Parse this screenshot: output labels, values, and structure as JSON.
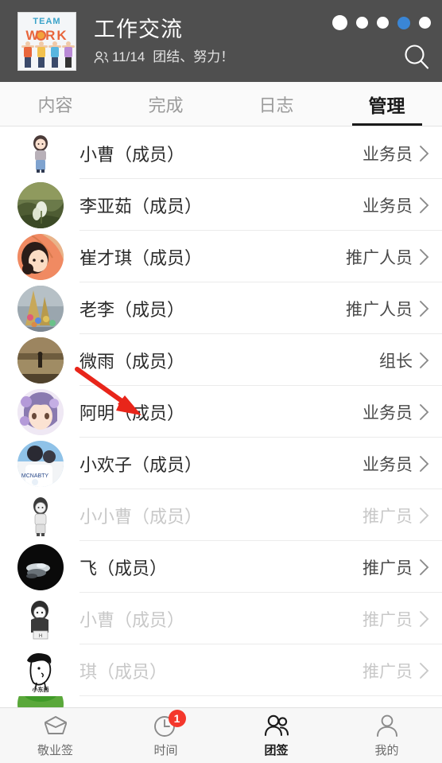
{
  "header": {
    "logo": {
      "name": "team-work-logo",
      "line1": "TEAM",
      "line2": "W  RK"
    },
    "title": "工作交流",
    "members_count": "11/14",
    "slogan": "团结、努力！",
    "people_icon": "people-icon",
    "search_icon": "search-icon",
    "dots": [
      "white",
      "white",
      "white",
      "blue",
      "white"
    ],
    "accent_dot_color": "#3a86d6",
    "background_color": "#4f4f4f"
  },
  "tabs": [
    {
      "label": "内容",
      "active": false
    },
    {
      "label": "完成",
      "active": false
    },
    {
      "label": "日志",
      "active": false
    },
    {
      "label": "管理",
      "active": true
    }
  ],
  "members": [
    {
      "name": "小曹（成员）",
      "role": "业务员",
      "dim": false
    },
    {
      "name": "李亚茹（成员）",
      "role": "业务员",
      "dim": false
    },
    {
      "name": "崔才琪（成员）",
      "role": "推广人员",
      "dim": false
    },
    {
      "name": "老李（成员）",
      "role": "推广人员",
      "dim": false
    },
    {
      "name": "微雨（成员）",
      "role": "组长",
      "dim": false
    },
    {
      "name": "阿明（成员）",
      "role": "业务员",
      "dim": false
    },
    {
      "name": "小欢子（成员）",
      "role": "业务员",
      "dim": false
    },
    {
      "name": "小小曹（成员）",
      "role": "推广员",
      "dim": true
    },
    {
      "name": "飞（成员）",
      "role": "推广员",
      "dim": false
    },
    {
      "name": "小曹（成员）",
      "role": "推广员",
      "dim": true
    },
    {
      "name": "琪（成员）",
      "role": "推广员",
      "dim": true
    }
  ],
  "avatar_labels": {
    "row11": "小东西"
  },
  "annotation": {
    "type": "red-arrow",
    "color": "#e8251a",
    "points_to": "阿明（成员）"
  },
  "bottom_nav": [
    {
      "label": "敬业签",
      "icon": "note-icon",
      "active": false,
      "badge": null
    },
    {
      "label": "时间",
      "icon": "clock-icon",
      "active": false,
      "badge": "1"
    },
    {
      "label": "团签",
      "icon": "group-icon",
      "active": true,
      "badge": null
    },
    {
      "label": "我的",
      "icon": "person-icon",
      "active": false,
      "badge": null
    }
  ]
}
